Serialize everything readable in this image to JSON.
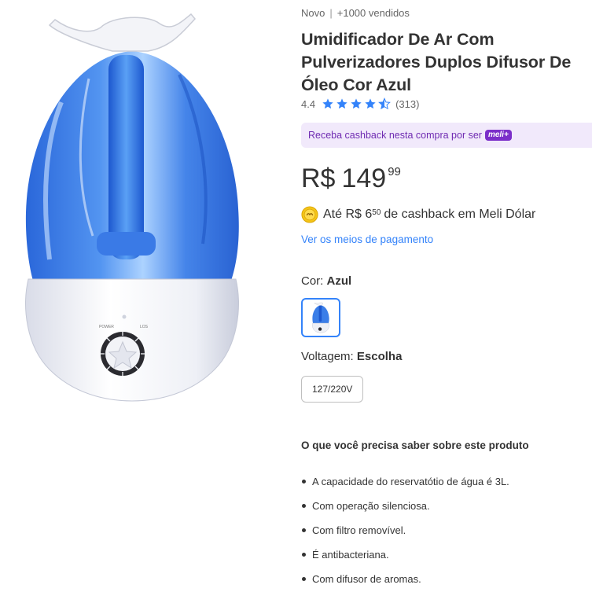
{
  "product": {
    "condition": "Novo",
    "separator": "|",
    "sold": "+1000 vendidos",
    "title": "Umidificador De Ar Com Pulverizadores Duplos Difusor De Óleo Cor Azul",
    "rating_value": "4.4",
    "rating_stars": 4.4,
    "rating_count": "(313)"
  },
  "cashback_banner": {
    "text": "Receba cashback nesta compra por ser",
    "badge": "meli+"
  },
  "price": {
    "currency": "R$",
    "whole": "149",
    "cents": "99"
  },
  "cashback": {
    "prefix": "Até R$ 6",
    "cents": "50",
    "suffix": "de cashback em Meli Dólar"
  },
  "payment_link": "Ver os meios de pagamento",
  "color": {
    "label": "Cor:",
    "value": "Azul"
  },
  "voltage": {
    "label": "Voltagem:",
    "value": "Escolha",
    "options": [
      "127/220V"
    ]
  },
  "features": {
    "title": "O que você precisa saber sobre este produto",
    "items": [
      "A capacidade do reservatótio de água é 3L.",
      "Com operação silenciosa.",
      "Com filtro removível.",
      "É antibacteriana.",
      "Com difusor de aromas."
    ]
  },
  "colors": {
    "link": "#3483fa",
    "star": "#3483fa",
    "banner_bg": "#f1e9fb",
    "banner_text": "#6f2bb2"
  }
}
